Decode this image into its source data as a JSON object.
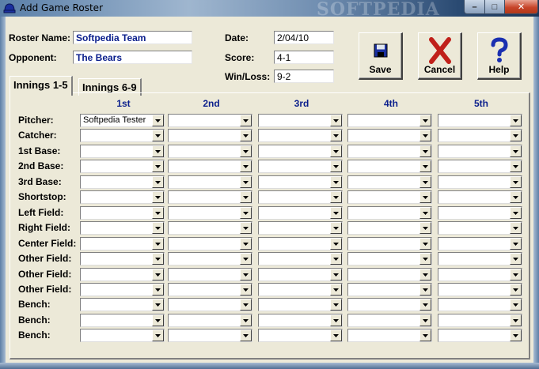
{
  "window": {
    "title": "Add Game Roster",
    "watermark": "SOFTPEDIA",
    "controls": {
      "minimize": "–",
      "maximize": "□",
      "close": "✕"
    }
  },
  "form": {
    "roster_name_label": "Roster Name:",
    "roster_name_value": "Softpedia Team",
    "opponent_label": "Opponent:",
    "opponent_value": "The Bears",
    "date_label": "Date:",
    "date_value": "2/04/10",
    "score_label": "Score:",
    "score_value": "4-1",
    "winloss_label": "Win/Loss:",
    "winloss_value": "9-2"
  },
  "toolbar": {
    "save_label": "Save",
    "cancel_label": "Cancel",
    "help_label": "Help"
  },
  "tabs": [
    {
      "label": "Innings 1-5",
      "active": true
    },
    {
      "label": "Innings 6-9",
      "active": false
    }
  ],
  "grid": {
    "columns": [
      "1st",
      "2nd",
      "3rd",
      "4th",
      "5th"
    ],
    "rows": [
      {
        "label": "Pitcher:",
        "values": [
          "Softpedia Tester",
          "",
          "",
          "",
          ""
        ]
      },
      {
        "label": "Catcher:",
        "values": [
          "",
          "",
          "",
          "",
          ""
        ]
      },
      {
        "label": "1st Base:",
        "values": [
          "",
          "",
          "",
          "",
          ""
        ]
      },
      {
        "label": "2nd Base:",
        "values": [
          "",
          "",
          "",
          "",
          ""
        ]
      },
      {
        "label": "3rd Base:",
        "values": [
          "",
          "",
          "",
          "",
          ""
        ]
      },
      {
        "label": "Shortstop:",
        "values": [
          "",
          "",
          "",
          "",
          ""
        ]
      },
      {
        "label": "Left Field:",
        "values": [
          "",
          "",
          "",
          "",
          ""
        ]
      },
      {
        "label": "Right Field:",
        "values": [
          "",
          "",
          "",
          "",
          ""
        ]
      },
      {
        "label": "Center Field:",
        "values": [
          "",
          "",
          "",
          "",
          ""
        ]
      },
      {
        "label": "Other Field:",
        "values": [
          "",
          "",
          "",
          "",
          ""
        ]
      },
      {
        "label": "Other Field:",
        "values": [
          "",
          "",
          "",
          "",
          ""
        ]
      },
      {
        "label": "Other Field:",
        "values": [
          "",
          "",
          "",
          "",
          ""
        ]
      },
      {
        "label": "Bench:",
        "values": [
          "",
          "",
          "",
          "",
          ""
        ]
      },
      {
        "label": "Bench:",
        "values": [
          "",
          "",
          "",
          "",
          ""
        ]
      },
      {
        "label": "Bench:",
        "values": [
          "",
          "",
          "",
          "",
          ""
        ]
      }
    ]
  },
  "colors": {
    "accent_text": "#0a1e8c",
    "face": "#ece9d8",
    "cancel_x": "#c0201a",
    "help_question": "#1a2fb0"
  },
  "icons": {
    "app": "baseball-cap-icon",
    "save": "floppy-disk-icon",
    "cancel": "red-x-icon",
    "help": "question-mark-icon",
    "combo_arrow": "chevron-down-icon"
  }
}
